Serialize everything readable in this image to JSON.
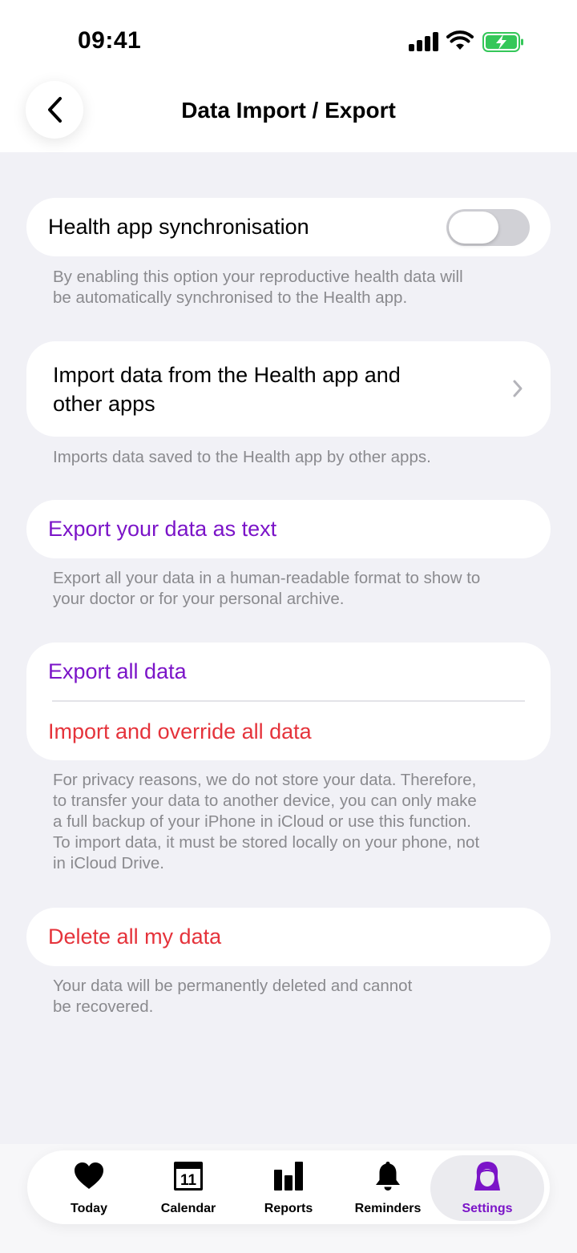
{
  "status_bar": {
    "time": "09:41"
  },
  "nav": {
    "title": "Data Import / Export"
  },
  "sync": {
    "label": "Health app synchronisation",
    "enabled": false,
    "footnote_line1": "By enabling this option your reproductive health data will",
    "footnote_line2": "be automatically synchronised to the Health app."
  },
  "import_health": {
    "label_line1": "Import data from the Health app and",
    "label_line2": "other apps",
    "footnote": "Imports data saved to the Health app by other apps."
  },
  "export_text": {
    "label": "Export your data as text",
    "footnote_line1": "Export all your data in a human-readable format to show to",
    "footnote_line2": "your doctor or for your personal archive."
  },
  "backup": {
    "export_label": "Export all data",
    "import_label": "Import and override all data",
    "footnote_lines": [
      "For privacy reasons, we do not store your data. Therefore,",
      "to transfer your data to another device, you can only make",
      "a full backup of your iPhone in iCloud or use this function.",
      "To import data, it must be stored locally on your phone, not",
      "in iCloud Drive."
    ]
  },
  "delete": {
    "label": "Delete all my data",
    "footnote_line1": "Your data will be permanently deleted and cannot",
    "footnote_line2": "be recovered."
  },
  "tabs": [
    {
      "label": "Today",
      "icon": "heart-icon"
    },
    {
      "label": "Calendar",
      "icon": "calendar-icon",
      "badge": "11"
    },
    {
      "label": "Reports",
      "icon": "bar-chart-icon"
    },
    {
      "label": "Reminders",
      "icon": "bell-icon"
    },
    {
      "label": "Settings",
      "icon": "woman-avatar-icon",
      "active": true
    }
  ],
  "colors": {
    "accent_purple": "#7B14C8",
    "destructive_red": "#E5333B",
    "background": "#F1F1F6",
    "battery_green": "#34C759"
  }
}
